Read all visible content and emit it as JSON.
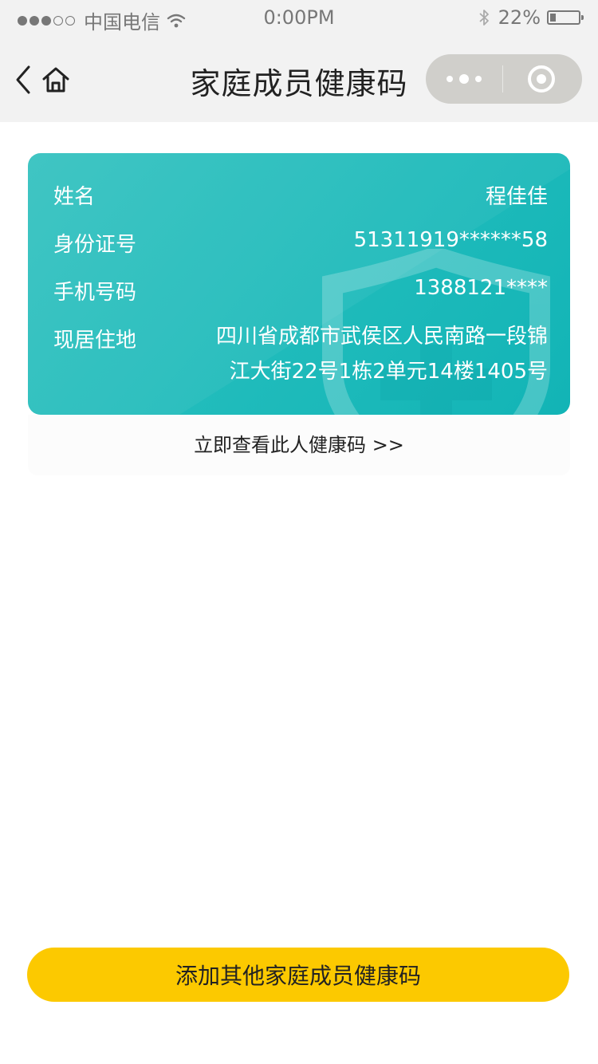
{
  "status_bar": {
    "carrier": "中国电信",
    "time": "0:00PM",
    "battery_percent": "22%",
    "battery_level": 0.22,
    "icons": [
      "signal-dots",
      "wifi-icon",
      "bluetooth-icon",
      "battery-icon"
    ]
  },
  "nav": {
    "title": "家庭成员健康码",
    "icons": [
      "back-chevron-icon",
      "home-icon",
      "more-dots-icon",
      "close-target-icon"
    ]
  },
  "member_card": {
    "name_label": "姓名",
    "name_value": "程佳佳",
    "id_label": "身份证号",
    "id_value": "51311919******58",
    "phone_label": "手机号码",
    "phone_value": "1388121****",
    "address_label": "现居住地",
    "address_value": "四川省成都市武侯区人民南路一段锦江大街22号1栋2单元14楼1405号",
    "background_color": "#22bcbc",
    "watermark_icon": "shield-cross-icon"
  },
  "view_link": {
    "label": "立即查看此人健康码 >>"
  },
  "add_button": {
    "label": "添加其他家庭成员健康码",
    "color": "#fcc900"
  }
}
